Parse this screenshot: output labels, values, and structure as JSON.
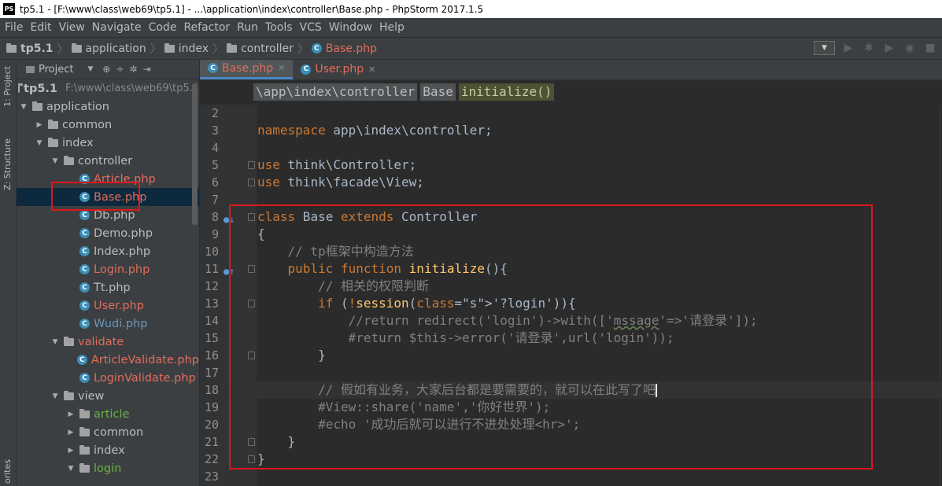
{
  "window": {
    "app_icon": "PS",
    "title": "tp5.1 - [F:\\www\\class\\web69\\tp5.1] - ...\\application\\index\\controller\\Base.php - PhpStorm 2017.1.5"
  },
  "menu": [
    "File",
    "Edit",
    "View",
    "Navigate",
    "Code",
    "Refactor",
    "Run",
    "Tools",
    "VCS",
    "Window",
    "Help"
  ],
  "navbar": {
    "crumbs": [
      {
        "label": "tp5.1",
        "icon": "folder-icon"
      },
      {
        "label": "application",
        "icon": "folder-icon"
      },
      {
        "label": "index",
        "icon": "folder-icon"
      },
      {
        "label": "controller",
        "icon": "folder-icon"
      },
      {
        "label": "Base.php",
        "icon": "php-class-icon"
      }
    ]
  },
  "toolstrip": {
    "project_tab": "1: Project",
    "structure_tab": "Z: Structure",
    "favorites_tab": "orites"
  },
  "project_panel": {
    "header": "Project",
    "root_label": "tp5.1",
    "root_path": "F:\\www\\class\\web69\\tp5.1",
    "items": [
      {
        "label": "application",
        "depth": 0,
        "type": "folder",
        "open": true
      },
      {
        "label": "common",
        "depth": 1,
        "type": "folder",
        "open": false
      },
      {
        "label": "index",
        "depth": 1,
        "type": "folder",
        "open": true
      },
      {
        "label": "controller",
        "depth": 2,
        "type": "folder",
        "open": true
      },
      {
        "label": "Article.php",
        "depth": 3,
        "type": "file",
        "color": "red"
      },
      {
        "label": "Base.php",
        "depth": 3,
        "type": "file",
        "color": "red",
        "selected": true
      },
      {
        "label": "Db.php",
        "depth": 3,
        "type": "file",
        "color": "normal"
      },
      {
        "label": "Demo.php",
        "depth": 3,
        "type": "file",
        "color": "normal"
      },
      {
        "label": "Index.php",
        "depth": 3,
        "type": "file",
        "color": "normal"
      },
      {
        "label": "Login.php",
        "depth": 3,
        "type": "file",
        "color": "red"
      },
      {
        "label": "Tt.php",
        "depth": 3,
        "type": "file",
        "color": "normal"
      },
      {
        "label": "User.php",
        "depth": 3,
        "type": "file",
        "color": "red"
      },
      {
        "label": "Wudi.php",
        "depth": 3,
        "type": "file",
        "color": "blue"
      },
      {
        "label": "validate",
        "depth": 2,
        "type": "folder",
        "open": true,
        "color": "red"
      },
      {
        "label": "ArticleValidate.php",
        "depth": 3,
        "type": "file",
        "color": "red"
      },
      {
        "label": "LoginValidate.php",
        "depth": 3,
        "type": "file",
        "color": "red"
      },
      {
        "label": "view",
        "depth": 2,
        "type": "folder",
        "open": true
      },
      {
        "label": "article",
        "depth": 3,
        "type": "folder",
        "open": false,
        "color": "green"
      },
      {
        "label": "common",
        "depth": 3,
        "type": "folder",
        "open": false
      },
      {
        "label": "index",
        "depth": 3,
        "type": "folder",
        "open": false
      },
      {
        "label": "login",
        "depth": 3,
        "type": "folder",
        "open": true,
        "color": "green"
      }
    ]
  },
  "editor": {
    "tabs": [
      {
        "label": "Base.php",
        "active": true,
        "color": "red"
      },
      {
        "label": "User.php",
        "active": false,
        "color": "red"
      }
    ],
    "breadcrumbs": [
      "\\app\\index\\controller",
      "Base",
      "initialize()"
    ],
    "lines": [
      {
        "n": "2",
        "code": ""
      },
      {
        "n": "3",
        "code": "namespace app\\index\\controller;"
      },
      {
        "n": "4",
        "code": ""
      },
      {
        "n": "5",
        "code": "use think\\Controller;"
      },
      {
        "n": "6",
        "code": "use think\\facade\\View;"
      },
      {
        "n": "7",
        "code": ""
      },
      {
        "n": "8",
        "code": "class Base extends Controller"
      },
      {
        "n": "9",
        "code": "{"
      },
      {
        "n": "10",
        "code": "    // tp框架中构造方法"
      },
      {
        "n": "11",
        "code": "    public function initialize(){"
      },
      {
        "n": "12",
        "code": "        // 相关的权限判断"
      },
      {
        "n": "13",
        "code": "        if (!session('?login')){"
      },
      {
        "n": "14",
        "code": "            //return redirect('login')->with(['mssage'=>'请登录']);"
      },
      {
        "n": "15",
        "code": "            #return $this->error('请登录',url('login'));"
      },
      {
        "n": "16",
        "code": "        }"
      },
      {
        "n": "17",
        "code": ""
      },
      {
        "n": "18",
        "code": "        // 假如有业务，大家后台都是要需要的，就可以在此写了吧"
      },
      {
        "n": "19",
        "code": "        #View::share('name','你好世界');"
      },
      {
        "n": "20",
        "code": "        #echo '成功后就可以进行不进处处理<hr>';"
      },
      {
        "n": "21",
        "code": "    }"
      },
      {
        "n": "22",
        "code": "}"
      },
      {
        "n": "23",
        "code": ""
      }
    ]
  }
}
